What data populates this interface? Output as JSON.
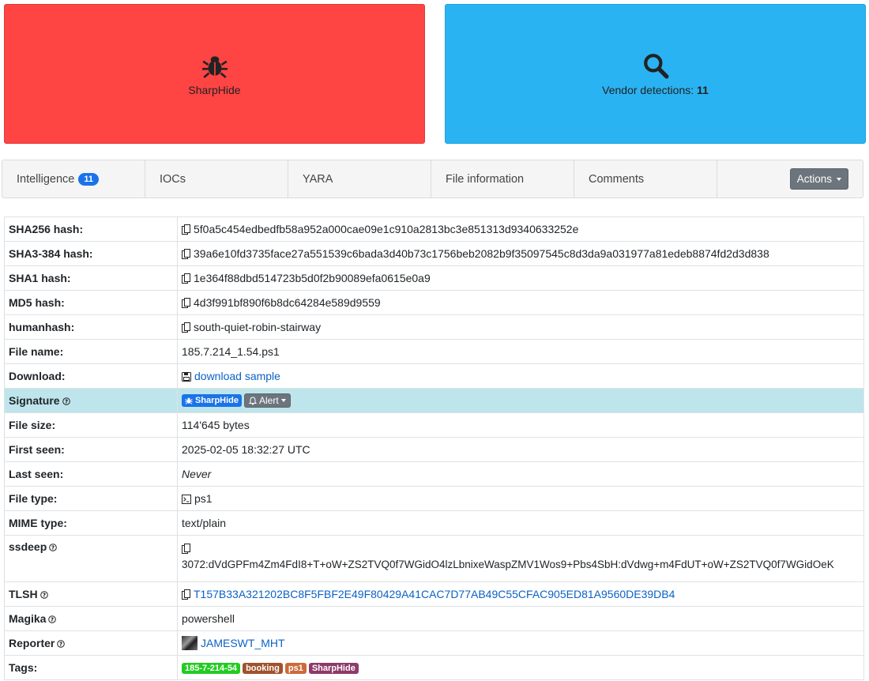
{
  "cards": {
    "signature": {
      "label": "SharpHide",
      "icon": "bug-icon",
      "color": "#ff4444"
    },
    "vendor": {
      "label": "Vendor detections: ",
      "count": "11",
      "icon": "search-icon",
      "color": "#2ab3f2"
    }
  },
  "tabs": [
    {
      "label": "Intelligence",
      "badge": "11"
    },
    {
      "label": "IOCs"
    },
    {
      "label": "YARA"
    },
    {
      "label": "File information"
    },
    {
      "label": "Comments"
    }
  ],
  "actions_label": "Actions",
  "rows": {
    "sha256": {
      "key": "SHA256 hash:",
      "value": "5f0a5c454edbedfb58a952a000cae09e1c910a2813bc3e851313d9340633252e"
    },
    "sha3": {
      "key": "SHA3-384 hash:",
      "value": "39a6e10fd3735face27a551539c6bada3d40b73c1756beb2082b9f35097545c8d3da9a031977a81edeb8874fd2d3d838"
    },
    "sha1": {
      "key": "SHA1 hash:",
      "value": "1e364f88dbd514723b5d0f2b90089efa0615e0a9"
    },
    "md5": {
      "key": "MD5 hash:",
      "value": "4d3f991bf890f6b8dc64284e589d9559"
    },
    "humanhash": {
      "key": "humanhash:",
      "value": "south-quiet-robin-stairway"
    },
    "filename": {
      "key": "File name:",
      "value": "185.7.214_1.54.ps1"
    },
    "download": {
      "key": "Download:",
      "value": "download sample"
    },
    "signature": {
      "key": "Signature",
      "badge": "SharpHide",
      "alert": "Alert"
    },
    "filesize": {
      "key": "File size:",
      "value": "114'645 bytes"
    },
    "firstseen": {
      "key": "First seen:",
      "value": "2025-02-05 18:32:27 UTC"
    },
    "lastseen": {
      "key": "Last seen:",
      "value": "Never"
    },
    "filetype": {
      "key": "File type:",
      "value": "ps1"
    },
    "mime": {
      "key": "MIME type:",
      "value": "text/plain"
    },
    "ssdeep": {
      "key": "ssdeep",
      "value": "3072:dVdGPFm4Zm4FdI8+T+oW+ZS2TVQ0f7WGidO4lzLbnixeWaspZMV1Wos9+Pbs4SbH:dVdwg+m4FdUT+oW+ZS2TVQ0f7WGidOeK"
    },
    "tlsh": {
      "key": "TLSH",
      "value": "T157B33A321202BC8F5FBF2E49F80429A41CAC7D77AB49C55CFAC905ED81A9560DE39DB4"
    },
    "magika": {
      "key": "Magika",
      "value": "powershell"
    },
    "reporter": {
      "key": "Reporter",
      "value": "JAMESWT_MHT"
    },
    "tags": {
      "key": "Tags:",
      "items": [
        {
          "label": "185-7-214-54",
          "color": "#22cc22"
        },
        {
          "label": "booking",
          "color": "#a0522d"
        },
        {
          "label": "ps1",
          "color": "#cd6a3a"
        },
        {
          "label": "SharpHide",
          "color": "#8e3a6a"
        }
      ]
    }
  }
}
